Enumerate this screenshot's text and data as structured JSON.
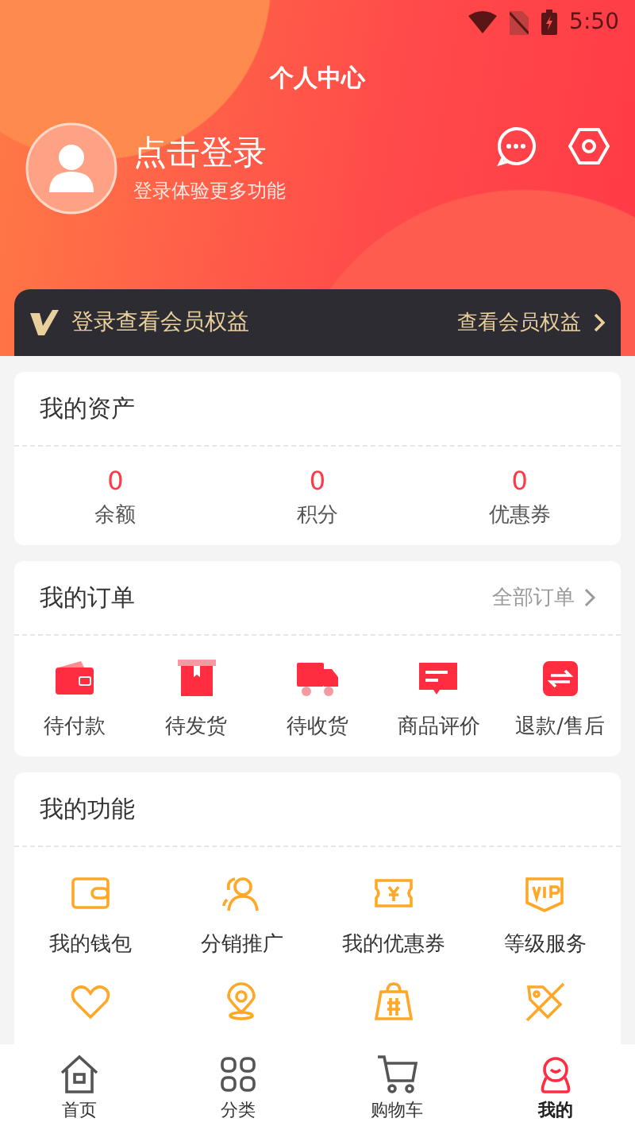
{
  "status_bar": {
    "time": "5:50"
  },
  "header": {
    "title": "个人中心",
    "login": "点击登录",
    "login_hint": "登录体验更多功能"
  },
  "vip_bar": {
    "text": "登录查看会员权益",
    "link": "查看会员权益"
  },
  "assets": {
    "title": "我的资产",
    "items": [
      {
        "value": "0",
        "label": "余额"
      },
      {
        "value": "0",
        "label": "积分"
      },
      {
        "value": "0",
        "label": "优惠券"
      }
    ]
  },
  "orders": {
    "title": "我的订单",
    "link": "全部订单",
    "items": [
      {
        "kind": "wallet",
        "label": "待付款"
      },
      {
        "kind": "box",
        "label": "待发货"
      },
      {
        "kind": "truck",
        "label": "待收货"
      },
      {
        "kind": "comment",
        "label": "商品评价"
      },
      {
        "kind": "exchange",
        "label": "退款/售后"
      }
    ]
  },
  "functions": {
    "title": "我的功能",
    "items": [
      {
        "kind": "wallet",
        "label": "我的钱包"
      },
      {
        "kind": "people",
        "label": "分销推广"
      },
      {
        "kind": "ticket",
        "label": "我的优惠券"
      },
      {
        "kind": "badge",
        "label": "等级服务"
      },
      {
        "kind": "heart"
      },
      {
        "kind": "pin"
      },
      {
        "kind": "bag"
      },
      {
        "kind": "tag"
      }
    ]
  },
  "nav": [
    {
      "kind": "home",
      "label": "首页",
      "selected": false
    },
    {
      "kind": "grid",
      "label": "分类",
      "selected": false
    },
    {
      "kind": "cart",
      "label": "购物车",
      "selected": false
    },
    {
      "kind": "me",
      "label": "我的",
      "selected": true
    }
  ]
}
